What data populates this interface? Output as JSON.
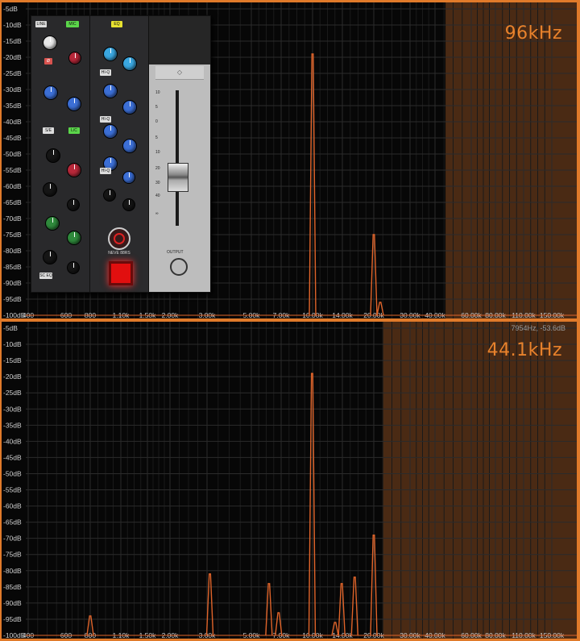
{
  "plots": [
    {
      "id": "top",
      "sample_rate_label": "96kHz",
      "cursor_readout": "",
      "shade_start_hz": 45000,
      "y_ticks": [
        "-5dB",
        "-10dB",
        "-15dB",
        "-20dB",
        "-25dB",
        "-30dB",
        "-35dB",
        "-40dB",
        "-45dB",
        "-50dB",
        "-55dB",
        "-60dB",
        "-65dB",
        "-70dB",
        "-75dB",
        "-80dB",
        "-85dB",
        "-90dB",
        "-95dB",
        "-100dB"
      ],
      "x_ticks": [
        "400",
        "600",
        "800",
        "1.10k",
        "1.50k",
        "2.00k",
        "3.00k",
        "5.00k",
        "7.00k",
        "10.00k",
        "14.00k",
        "20.00k",
        "30.00k",
        "40.00k",
        "60.00k",
        "80.00k",
        "110.00k",
        "150.00k"
      ],
      "spikes": [
        {
          "freq_hz": 10000,
          "db": -19
        },
        {
          "freq_hz": 20000,
          "db": -75
        },
        {
          "freq_hz": 21500,
          "db": -96
        }
      ],
      "has_plugin_overlay": true
    },
    {
      "id": "bottom",
      "sample_rate_label": "44.1kHz",
      "cursor_readout": "7954Hz, -53.6dB",
      "shade_start_hz": 22050,
      "y_ticks": [
        "-5dB",
        "-10dB",
        "-15dB",
        "-20dB",
        "-25dB",
        "-30dB",
        "-35dB",
        "-40dB",
        "-45dB",
        "-50dB",
        "-55dB",
        "-60dB",
        "-65dB",
        "-70dB",
        "-75dB",
        "-80dB",
        "-85dB",
        "-90dB",
        "-95dB",
        "-100dB"
      ],
      "x_ticks": [
        "400",
        "600",
        "800",
        "1.10k",
        "1.50k",
        "2.00k",
        "3.00k",
        "5.00k",
        "7.00k",
        "10.00k",
        "14.00k",
        "20.00k",
        "30.00k",
        "40.00k",
        "60.00k",
        "80.00k",
        "110.00k",
        "150.00k"
      ],
      "spikes": [
        {
          "freq_hz": 800,
          "db": -94
        },
        {
          "freq_hz": 3100,
          "db": -81
        },
        {
          "freq_hz": 6100,
          "db": -84
        },
        {
          "freq_hz": 6800,
          "db": -93
        },
        {
          "freq_hz": 9950,
          "db": -19
        },
        {
          "freq_hz": 12900,
          "db": -96
        },
        {
          "freq_hz": 13900,
          "db": -84
        },
        {
          "freq_hz": 16100,
          "db": -82
        },
        {
          "freq_hz": 20000,
          "db": -69
        }
      ],
      "has_plugin_overlay": false
    }
  ],
  "plugin": {
    "buttons": [
      "LINE",
      "MIC",
      "Ø",
      "EQ",
      "HI-Q",
      "HI-Q",
      "S/E",
      "L/C",
      "EXP",
      "LINK",
      "SC EQ",
      "HI-Q"
    ],
    "brand_label": "NEVE 88RS",
    "output_label": "OUTPUT",
    "fader_scale": [
      "10",
      "5",
      "0",
      "5",
      "10",
      "20",
      "30",
      "40",
      "∞"
    ],
    "meter_scale": [
      "+3",
      "0",
      "-3",
      "-20"
    ]
  },
  "colors": {
    "frame": "#e07a2a",
    "background": "#070707",
    "grid": "#2b2b2b",
    "shade": "#4a2a14",
    "spike": "#e0642a",
    "tick_text": "#cfcfcf"
  }
}
